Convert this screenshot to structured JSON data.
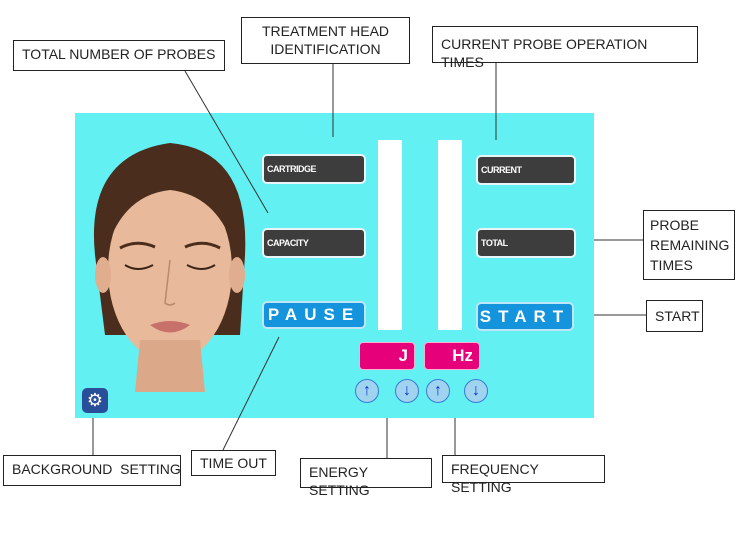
{
  "callouts": {
    "total_probes": "TOTAL NUMBER OF PROBES",
    "treatment_head": "TREATMENT HEAD IDENTIFICATION",
    "current_probe": "CURRENT PROBE OPERATION TIMES",
    "probe_remaining": "PROBE REMAINING TIMES",
    "start": "START",
    "background_setting": "BACKGROUND  SETTING",
    "time_out": "TIME OUT",
    "energy_setting": "ENERGY SETTING",
    "frequency_setting": "FREQUENCY SETTING"
  },
  "panel": {
    "background_color": "#62f0f2",
    "cartridge_label": "CARTRIDGE",
    "capacity_label": "CAPACITY",
    "current_label": "CURRENT",
    "total_label": "TOTAL",
    "pause_button": "PAUSE",
    "start_button": "START",
    "energy_unit": "J",
    "frequency_unit": "Hz",
    "arrows": {
      "up": "↑",
      "down": "↓"
    },
    "icons": [
      "gear-icon",
      "arrow-up-icon",
      "arrow-down-icon"
    ]
  }
}
